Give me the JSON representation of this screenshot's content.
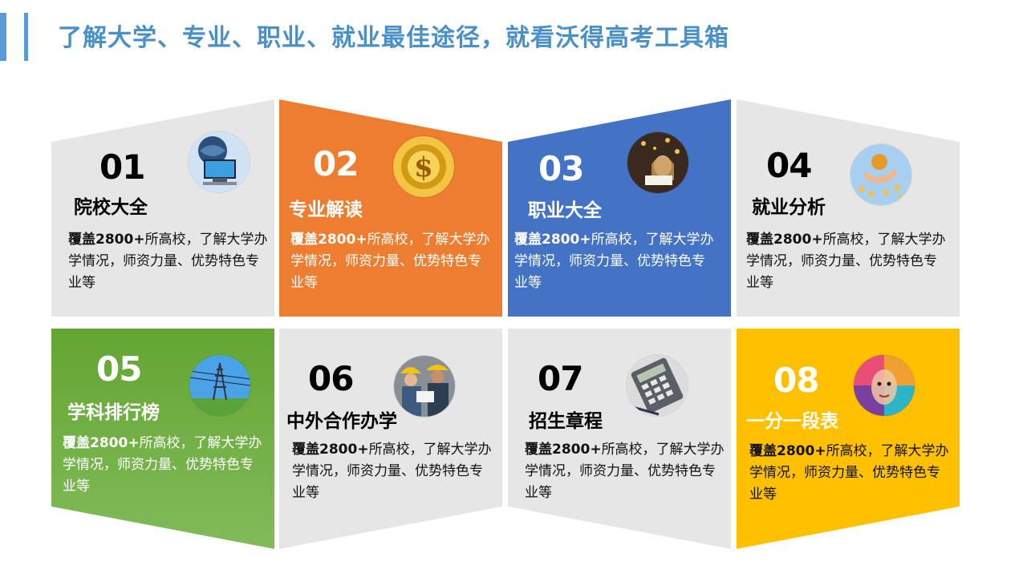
{
  "title": "了解大学、专业、职业、就业最佳途径，就看沃得高考工具箱",
  "colors": {
    "accent": "#5b9bd5",
    "title": "#4a90c8",
    "gray": "#e7e6e6",
    "orange": "#ed7d31",
    "blue": "#4472c4",
    "green": "#70ad47",
    "gold": "#ffc000"
  },
  "tiles": [
    {
      "num": "01",
      "heading": "院校大全",
      "desc_bold": "覆盖2800+",
      "desc_rest": "所高校，了解大学办学情况，师资力量、优势特色专业等",
      "icon": "computer-globe-icon"
    },
    {
      "num": "02",
      "heading": "专业解读",
      "desc_bold": "覆盖2800+",
      "desc_rest": "所高校，了解大学办学情况，师资力量、优势特色专业等",
      "icon": "gold-dollar-icon"
    },
    {
      "num": "03",
      "heading": "职业大全",
      "desc_bold": "覆盖2800+",
      "desc_rest": "所高校，了解大学办学情况，师资力量、优势特色专业等",
      "icon": "woman-reading-icon"
    },
    {
      "num": "04",
      "heading": "就业分析",
      "desc_bold": "覆盖2800+",
      "desc_rest": "所高校，了解大学办学情况，师资力量、优势特色专业等",
      "icon": "gold-coins-hand-icon"
    },
    {
      "num": "05",
      "heading": "学科排行榜",
      "desc_bold": "覆盖2800+",
      "desc_rest": "所高校，了解大学办学情况，师资力量、优势特色专业等",
      "icon": "power-tower-icon"
    },
    {
      "num": "06",
      "heading": "中外合作办学",
      "desc_bold": "覆盖2800+",
      "desc_rest": "所高校，了解大学办学情况，师资力量、优势特色专业等",
      "icon": "engineers-icon"
    },
    {
      "num": "07",
      "heading": "招生章程",
      "desc_bold": "覆盖2800+",
      "desc_rest": "所高校，了解大学办学情况，师资力量、优势特色专业等",
      "icon": "calculator-icon"
    },
    {
      "num": "08",
      "heading": "一分一段表",
      "desc_bold": "覆盖2800+",
      "desc_rest": "所高校，了解大学办学情况，师资力量、优势特色专业等",
      "icon": "colorful-face-icon"
    }
  ]
}
